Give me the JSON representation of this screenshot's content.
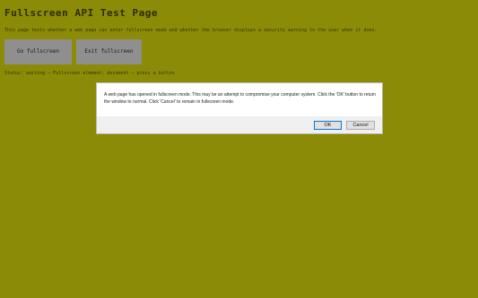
{
  "page": {
    "title": "Fullscreen API Test Page",
    "description": "This page tests whether a web page can enter fullscreen mode and whether the browser displays a security warning to the user when it does.",
    "buttons": {
      "enter_label": "Go fullscreen",
      "exit_label": "Exit fullscreen"
    },
    "status": "Status: waiting — Fullscreen element: document — press a button"
  },
  "dialog": {
    "message": "A web page has opened in fullscreen mode. This may be an attempt to compromise your computer system. Click the 'OK' button to return the window to normal. Click 'Cancel' to remain in fullscreen mode.",
    "ok_label": "OK",
    "cancel_label": "Cancel"
  },
  "colors": {
    "page_background": "#8b8b08",
    "page_button": "#8f8f8f",
    "dialog_background": "#f0f0f0",
    "ok_border_accent": "#0078d7"
  }
}
